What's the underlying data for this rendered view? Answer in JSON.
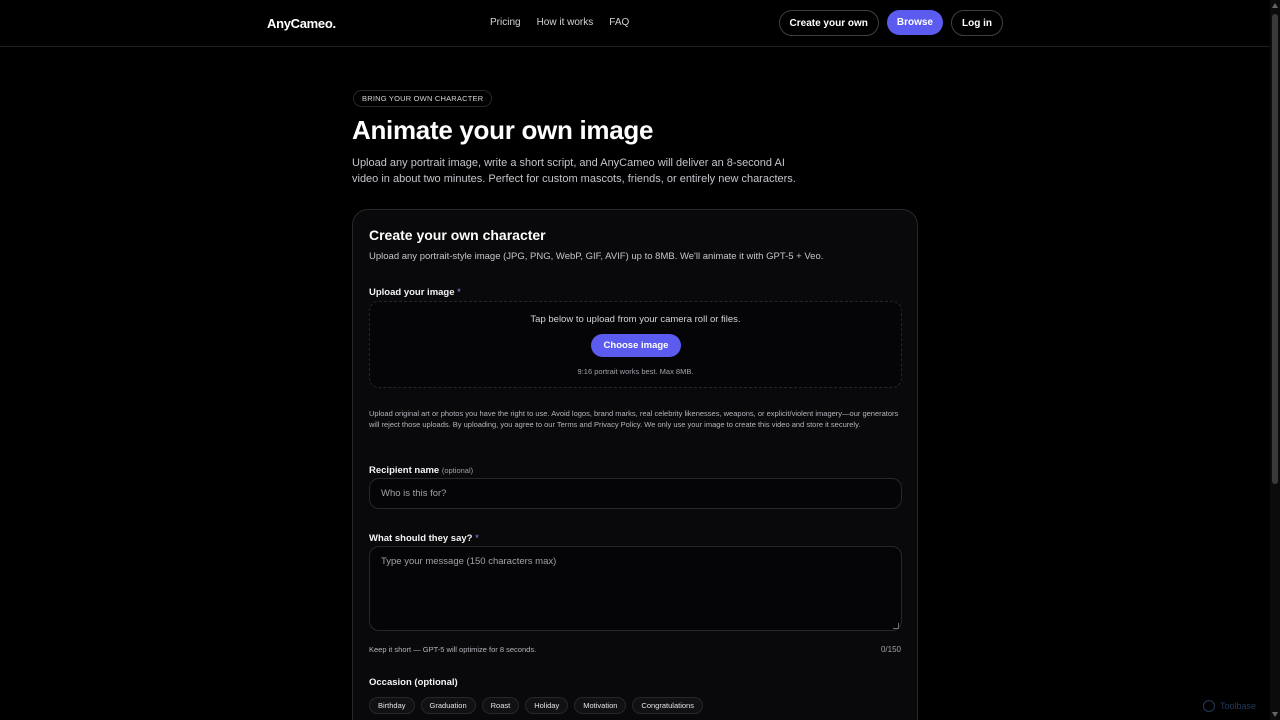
{
  "nav": {
    "brand": "AnyCameo.",
    "links": [
      "Pricing",
      "How it works",
      "FAQ"
    ],
    "create_label": "Create your own",
    "browse_label": "Browse",
    "login_label": "Log in"
  },
  "hero": {
    "eyebrow": "BRING YOUR OWN CHARACTER",
    "title": "Animate your own image",
    "description": "Upload any portrait image, write a short script, and AnyCameo will deliver an 8-second AI video in about two minutes. Perfect for custom mascots, friends, or entirely new characters."
  },
  "form": {
    "title": "Create your own character",
    "subtitle": "Upload any portrait-style image (JPG, PNG, WebP, GIF, AVIF) up to 8MB. We'll animate it with GPT-5 + Veo.",
    "upload": {
      "label": "Upload your image",
      "required_mark": "*",
      "tip": "Tap below to upload from your camera roll or files.",
      "button_label": "Choose image",
      "hint": "9:16 portrait works best. Max 8MB."
    },
    "legal": "Upload original art or photos you have the right to use. Avoid logos, brand marks, real celebrity likenesses, weapons, or explicit/violent imagery—our generators will reject those uploads. By uploading, you agree to our Terms and Privacy Policy. We only use your image to create this video and store it securely.",
    "recipient": {
      "label": "Recipient name",
      "optional_note": "(optional)",
      "placeholder": "Who is this for?",
      "value": ""
    },
    "message": {
      "label": "What should they say?",
      "required_mark": "*",
      "placeholder": "Type your message (150 characters max)",
      "helper": "Keep it short — GPT-5 will optimize for 8 seconds.",
      "counter": "0/150"
    },
    "occasion": {
      "label": "Occasion (optional)",
      "chips": [
        "Birthday",
        "Graduation",
        "Roast",
        "Holiday",
        "Motivation",
        "Congratulations"
      ]
    }
  },
  "watermark": "Toolbase",
  "colors": {
    "accent": "#5b5bf0",
    "background": "#000000",
    "card": "#09090b",
    "border": "#27272a"
  }
}
